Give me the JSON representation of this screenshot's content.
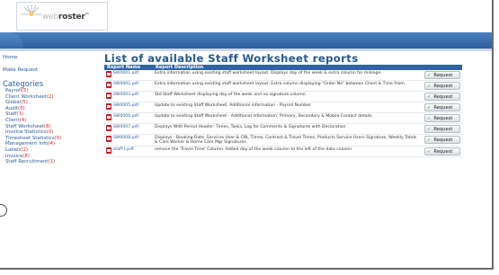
{
  "logo": {
    "part1": "web",
    "part2": "roster",
    "tm": "™"
  },
  "sidebar": {
    "links": [
      "Home",
      "Make Request"
    ],
    "categories_title": "Categories",
    "categories": [
      {
        "label": "Payroll",
        "count": "(5)"
      },
      {
        "label": "Client Worksheet",
        "count": "(2)"
      },
      {
        "label": "Global",
        "count": "(5)"
      },
      {
        "label": "Audit",
        "count": "(0)"
      },
      {
        "label": "Staff",
        "count": "(3)"
      },
      {
        "label": "Client",
        "count": "(4)"
      },
      {
        "label": "Staff Worksheet",
        "count": "(8)"
      },
      {
        "label": "Invoice Statistics",
        "count": "(0)"
      },
      {
        "label": "Timesheet Statistics",
        "count": "(0)"
      },
      {
        "label": "Management Info",
        "count": "(4)"
      },
      {
        "label": "Labels",
        "count": "(2)"
      },
      {
        "label": "Invoice",
        "count": "(8)"
      },
      {
        "label": "Staff Recruitment",
        "count": "(1)"
      }
    ]
  },
  "main": {
    "title": "List of available Staff Worksheet reports",
    "columns": [
      "Report Name",
      "Report Description"
    ],
    "button_label": "Request",
    "rows": [
      {
        "name": "SW0001.pdf",
        "desc": "Extra information using existing staff worksheet layout. Displays day of the week & extra column for mileage."
      },
      {
        "name": "SW0002.pdf",
        "desc": "Extra information using existing staff worksheet layout: Extra column displaying \"Order No\" between Client & Time From."
      },
      {
        "name": "SW0003.pdf",
        "desc": "Std Staff Worksheet displaying day of the week and no signature column."
      },
      {
        "name": "SW0005.pdf",
        "desc": "Update to existing Staff Worksheet. Additional information - Payroll Number"
      },
      {
        "name": "SW0006.pdf",
        "desc": "Update to existing Staff Worksheet - Additional information: Primary, Secondary & Mobile Contact details."
      },
      {
        "name": "SW0007.pdf",
        "desc": "Displays With Period Header: Times, Tasks, Log for Comments & Signatures with Declaration"
      },
      {
        "name": "SW0008.pdf",
        "desc": "Displays - Booking Date, Services User & CIN, Times, Contract & Travel Times, Products Service Users Signature, Weekly Totals & Care Worker & Home Care Mgr Signatures"
      },
      {
        "name": "staff-t.pdf",
        "desc": "remove the 'Travel Time' Column. Added day of the week column to the left of the date column"
      }
    ]
  }
}
